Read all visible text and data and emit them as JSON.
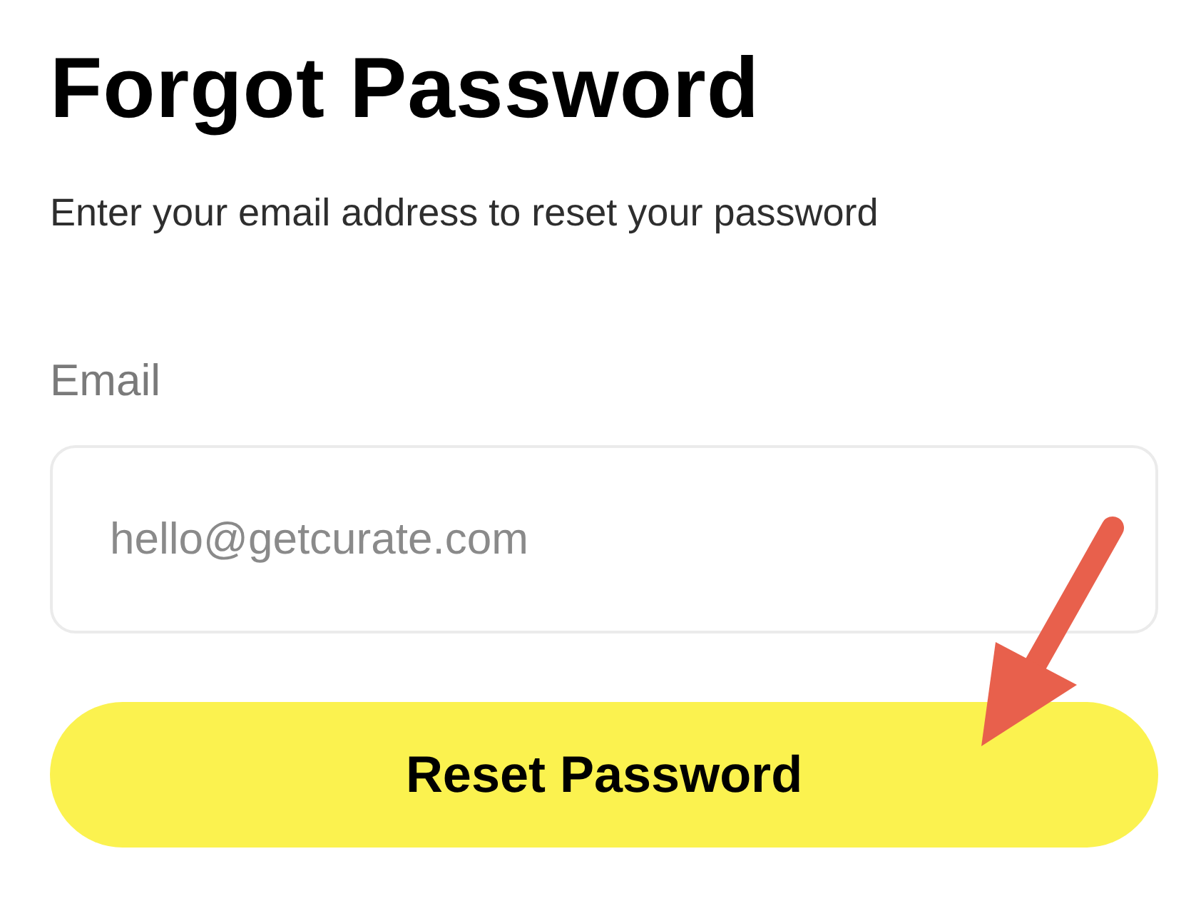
{
  "title": "Forgot Password",
  "subtitle": "Enter your email address to reset your password",
  "email_field": {
    "label": "Email",
    "placeholder": "hello@getcurate.com"
  },
  "button": {
    "label": "Reset Password"
  }
}
